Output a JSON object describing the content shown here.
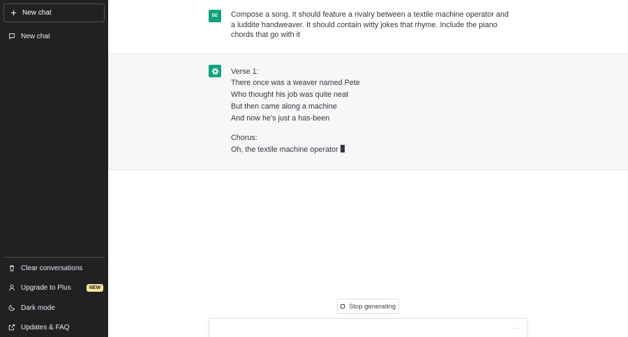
{
  "sidebar": {
    "new_chat_button": "New chat",
    "history": [
      {
        "label": "New chat"
      }
    ],
    "bottom": [
      {
        "label": "Clear conversations",
        "icon": "trash-icon"
      },
      {
        "label": "Upgrade to Plus",
        "icon": "user-icon",
        "badge": "NEW"
      },
      {
        "label": "Dark mode",
        "icon": "moon-icon"
      },
      {
        "label": "Updates & FAQ",
        "icon": "external-link-icon"
      }
    ]
  },
  "conversation": {
    "user": {
      "avatar": "BE",
      "text": "Compose a song. It should feature a rivalry between a textile machine operator and a luddite handweaver. It should contain witty jokes that rhyme. Include the piano chords that go with it"
    },
    "assistant": {
      "lines": [
        "Verse 1:",
        "There once was a weaver named Pete",
        "Who thought his job was quite neat",
        "But then came along a machine",
        "And now he's just a has-been",
        "Chorus:",
        "Oh, the textile machine operator"
      ]
    }
  },
  "composer": {
    "stop_button": "Stop generating",
    "value": "",
    "loading_indicator": "··"
  },
  "colors": {
    "sidebar_bg": "#202123",
    "accent": "#10a37f",
    "assistant_bg": "#f7f7f8",
    "badge": "#fae69e"
  }
}
